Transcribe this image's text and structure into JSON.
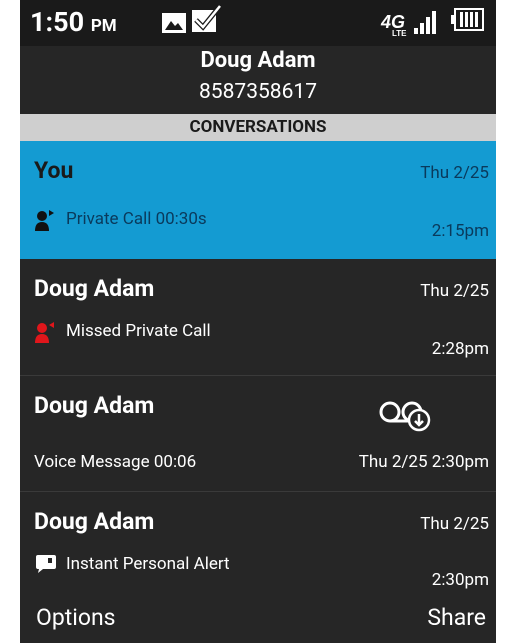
{
  "status": {
    "time": "1:50",
    "ampm": "PM"
  },
  "header": {
    "name": "Doug Adam",
    "number": "8587358617"
  },
  "section_title": "CONVERSATIONS",
  "conversations": [
    {
      "title": "You",
      "date": "Thu 2/25",
      "desc": "Private Call  00:30s",
      "time": "2:15pm",
      "icon": "outgoing-call-icon"
    },
    {
      "title": "Doug Adam",
      "date": "Thu 2/25",
      "desc": "Missed Private Call",
      "time": "2:28pm",
      "icon": "missed-call-icon"
    },
    {
      "title": "Doug Adam",
      "date": "",
      "desc": "Voice Message  00:06",
      "time": "Thu 2/25 2:30pm",
      "icon": "voicemail-download-icon"
    },
    {
      "title": "Doug Adam",
      "date": "Thu 2/25",
      "desc": "Instant Personal Alert",
      "time": "2:30pm",
      "icon": "alert-message-icon"
    }
  ],
  "footer": {
    "left": "Options",
    "right": "Share"
  },
  "colors": {
    "selected": "#149bd2",
    "missed": "#e0161b",
    "background": "#262626"
  }
}
